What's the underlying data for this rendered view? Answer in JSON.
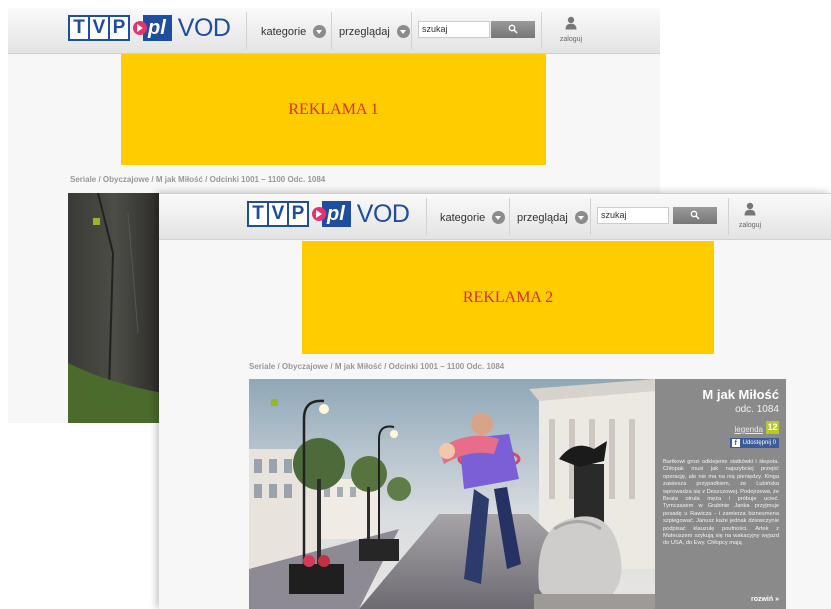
{
  "logo": {
    "tvp_letters": [
      "T",
      "V",
      "P"
    ],
    "pl": "pl",
    "vod": "VOD"
  },
  "nav": {
    "categories_label": "kategorie",
    "browse_label": "przeglądaj",
    "search_placeholder": "szukaj",
    "login_label": "zaloguj"
  },
  "icons": {
    "categories_chevron": "chevron-down-icon",
    "browse_chevron": "chevron-down-icon",
    "search_button": "search-icon",
    "login": "user-icon",
    "share": "facebook-icon"
  },
  "windows": [
    {
      "ad_label": "REKLAMA 1",
      "breadcrumb": "Seriale / Obyczajowe / M jak Miłość / Odcinki 1001 – 1100 Odc. 1084"
    },
    {
      "ad_label": "REKLAMA 2",
      "breadcrumb": "Seriale / Obyczajowe / M jak Miłość / Odcinki 1001 – 1100 Odc. 1084"
    }
  ],
  "episode": {
    "title": "M jak Miłość",
    "number": "odc. 1084",
    "legend_link": "legenda",
    "age_rating": "12",
    "share_label": "Udostępnij 0",
    "description": "Bartkowi grozi odklejenie siatkówki i ślepota. Chłopak musi jak najszybciej przejść operację, ale nie ma na nią pieniędzy. Kinga zawiesza przypadkiem, że Lubińska wprowadza się z Deszczowej. Podejrzewa, że Beata otruła męża i próbuje ucieć. Tymczasem w Grabinie Janka przyjmuje posadę u Rawicza - i zamierza biznesmena szpiegować. Janusz każe jednak dziewczynie podpisać klauzulę poufności. Artek z Mateuszem szykują się na wakacyjny wyjazd do USA, do Ewy. Chłopcy mają",
    "more_label": "rozwiń »"
  },
  "colors": {
    "brand_blue": "#1f4ea0",
    "brand_pink": "#e8316f",
    "ad_yellow": "#ffcc00",
    "ad_text": "#d63027",
    "panel_gray": "#8a8a8a",
    "age_badge": "#b8c82a",
    "facebook": "#3b5b9a"
  }
}
